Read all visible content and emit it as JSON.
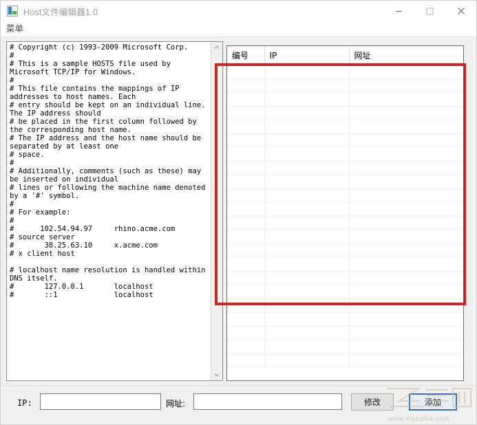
{
  "window": {
    "title": "Host文件编辑器1.0",
    "icon": "app-icon",
    "controls": {
      "minimize": "minimize-icon",
      "maximize": "maximize-icon",
      "close": "close-icon"
    }
  },
  "menu": {
    "items": [
      {
        "label": "菜单"
      }
    ]
  },
  "editor": {
    "content": "# Copyright (c) 1993-2009 Microsoft Corp.\n#\n# This is a sample HOSTS file used by Microsoft TCP/IP for Windows.\n#\n# This file contains the mappings of IP addresses to host names. Each\n# entry should be kept on an individual line. The IP address should\n# be placed in the first column followed by the corresponding host name.\n# The IP address and the host name should be separated by at least one\n# space.\n#\n# Additionally, comments (such as these) may be inserted on individual\n# lines or following the machine name denoted by a '#' symbol.\n#\n# For example:\n#\n#      102.54.94.97     rhino.acme.com\n# source server\n#       38.25.63.10     x.acme.com\n# x client host\n\n# localhost name resolution is handled within DNS itself.\n#       127.0.0.1       localhost\n#       ::1             localhost",
    "scrollbar": {
      "up_arrow": "chevron-up-icon",
      "down_arrow": "chevron-down-icon"
    }
  },
  "records": {
    "columns": [
      "编号",
      "IP",
      "网址"
    ],
    "rows": [],
    "empty_row_count": 22
  },
  "annotation": {
    "color": "#c9271f",
    "shape": "rectangle"
  },
  "form": {
    "ip_label": "IP:",
    "ip_value": "",
    "ip_placeholder": "",
    "url_label": "网址:",
    "url_value": "",
    "url_placeholder": "",
    "modify_label": "修改",
    "add_label": "添加",
    "focus_color": "#2f74c0"
  },
  "watermark": {
    "url": "www.xiazaiba.com"
  }
}
